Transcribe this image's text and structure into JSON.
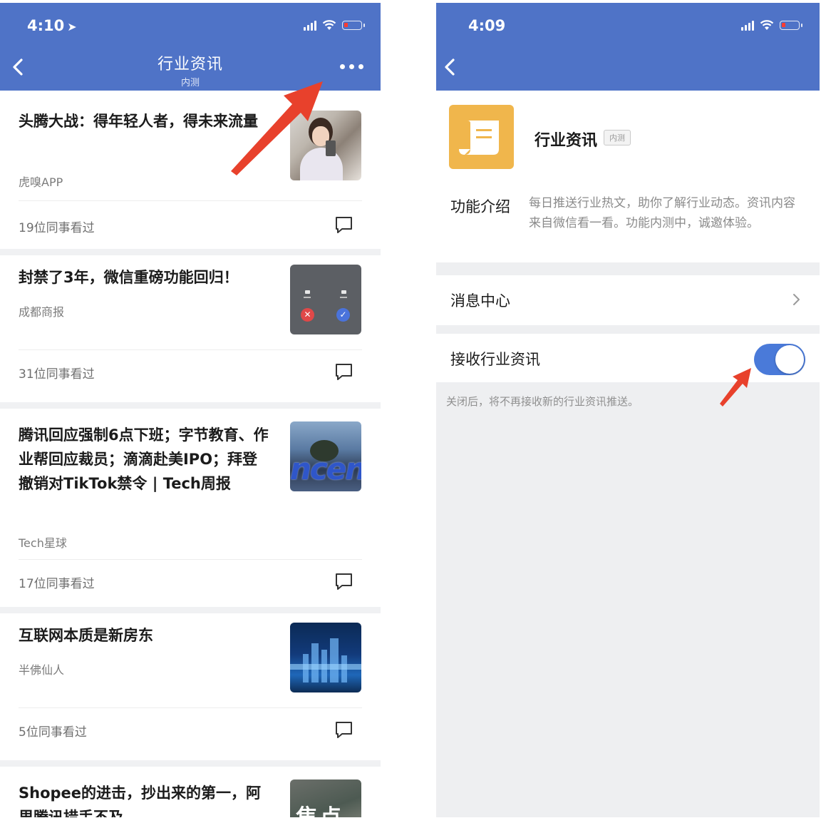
{
  "left_screen": {
    "status": {
      "time": "4:10"
    },
    "header": {
      "title": "行业资讯",
      "subtitle": "内测"
    },
    "articles": [
      {
        "title": "头腾大战：得年轻人者，得未来流量",
        "source": "虎嗅APP",
        "views": "19位同事看过"
      },
      {
        "title": "封禁了3年，微信重磅功能回归！",
        "source": "成都商报",
        "views": "31位同事看过"
      },
      {
        "title": "腾讯回应强制6点下班；字节教育、作业帮回应裁员；滴滴赴美IPO；拜登撤销对TikTok禁令 | Tech周报",
        "source": "Tech星球",
        "views": "17位同事看过",
        "thumb_text": "ncent"
      },
      {
        "title": "互联网本质是新房东",
        "source": "半佛仙人",
        "views": "5位同事看过"
      },
      {
        "title": "Shopee的进击，抄出来的第一，阿里腾讯措手不及",
        "thumb_text": "焦点"
      }
    ]
  },
  "right_screen": {
    "status": {
      "time": "4:09"
    },
    "app": {
      "name": "行业资讯",
      "badge": "内测"
    },
    "intro": {
      "label": "功能介绍",
      "text": "每日推送行业热文，助你了解行业动态。资讯内容来自微信看一看。功能内测中，诚邀体验。"
    },
    "message_center": {
      "label": "消息中心"
    },
    "receive": {
      "label": "接收行业资讯",
      "enabled": true
    },
    "note": "关闭后，将不再接收新的行业资讯推送。"
  },
  "colors": {
    "header": "#4f73c7",
    "toggle_on": "#4a7ad9",
    "app_icon": "#f0b64c",
    "annotation_arrow": "#e8412c"
  }
}
